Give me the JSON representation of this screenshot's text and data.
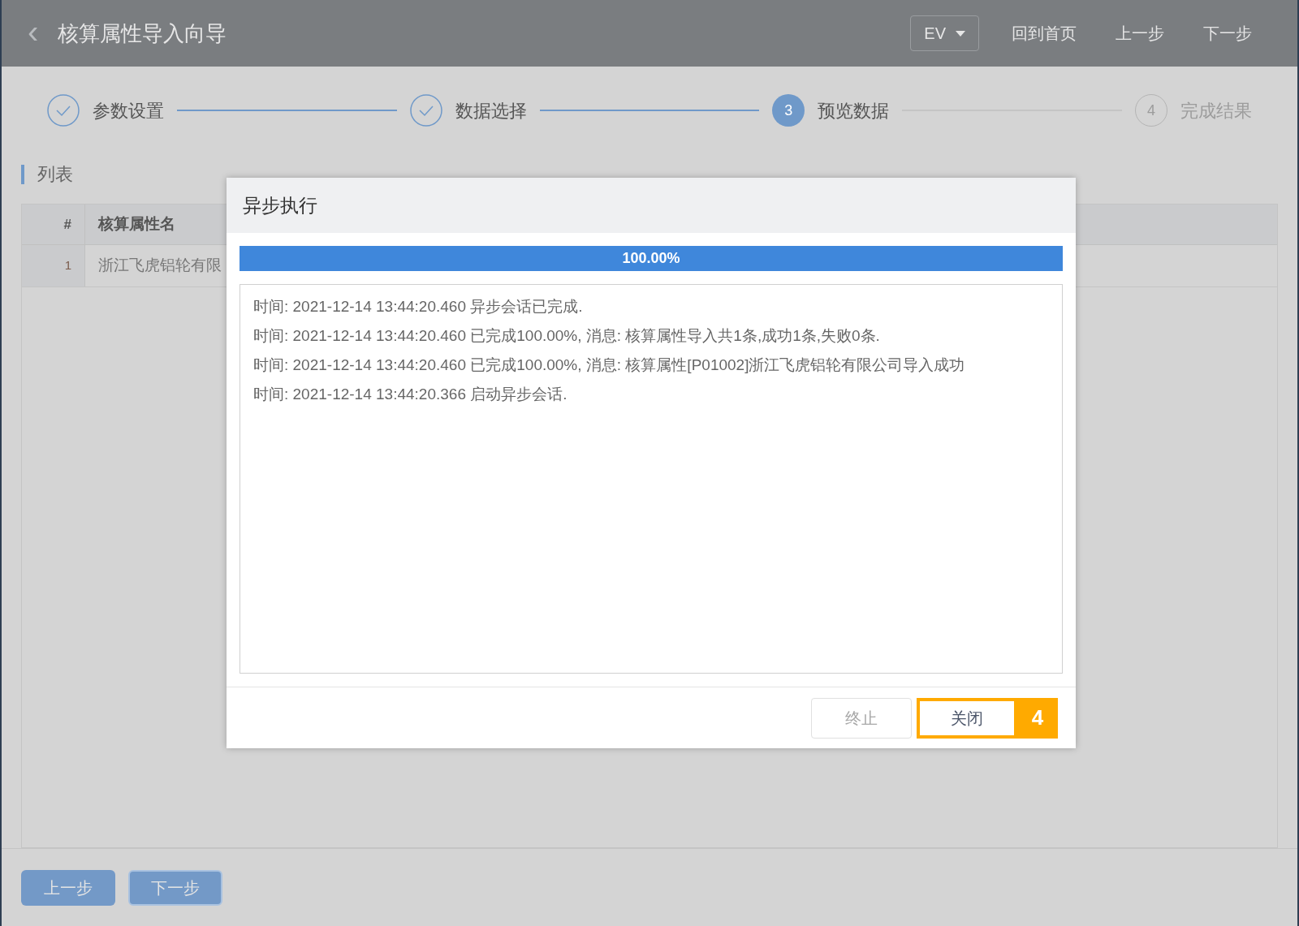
{
  "header": {
    "back_icon": "‹",
    "title": "核算属性导入向导",
    "language": "EV",
    "actions": [
      "回到首页",
      "上一步",
      "下一步"
    ]
  },
  "steps": [
    {
      "label": "参数设置",
      "done": true,
      "selected": false
    },
    {
      "label": "数据选择",
      "done": true,
      "selected": false
    },
    {
      "number": "3",
      "label": "预览数据",
      "done": false,
      "selected": true
    },
    {
      "number": "4",
      "label": "完成结果",
      "done": false,
      "selected": false
    }
  ],
  "section_title": "列表",
  "table": {
    "columns": [
      "#",
      "核算属性名"
    ],
    "rows": [
      [
        "1",
        "浙江飞虎铝轮有限"
      ]
    ]
  },
  "dialog": {
    "title": "异步执行",
    "progress": {
      "level": 1,
      "reading": "100.00%"
    },
    "log": [
      "时间: 2021-12-14 13:44:20.460 异步会话已完成.",
      "时间: 2021-12-14 13:44:20.460 已完成100.00%, 消息: 核算属性导入共1条,成功1条,失败0条.",
      "时间: 2021-12-14 13:44:20.460 已完成100.00%, 消息: 核算属性[P01002]浙江飞虎铝轮有限公司导入成功",
      "时间: 2021-12-14 13:44:20.366 启动异步会话."
    ],
    "buttons": [
      {
        "label": "终止",
        "disabled": true,
        "highlighted": false
      },
      {
        "label": "关闭",
        "disabled": false,
        "highlighted": true,
        "callout": "4"
      }
    ]
  },
  "footer_buttons": [
    {
      "label": "上一步",
      "focused": false
    },
    {
      "label": "下一步",
      "focused": true
    }
  ]
}
